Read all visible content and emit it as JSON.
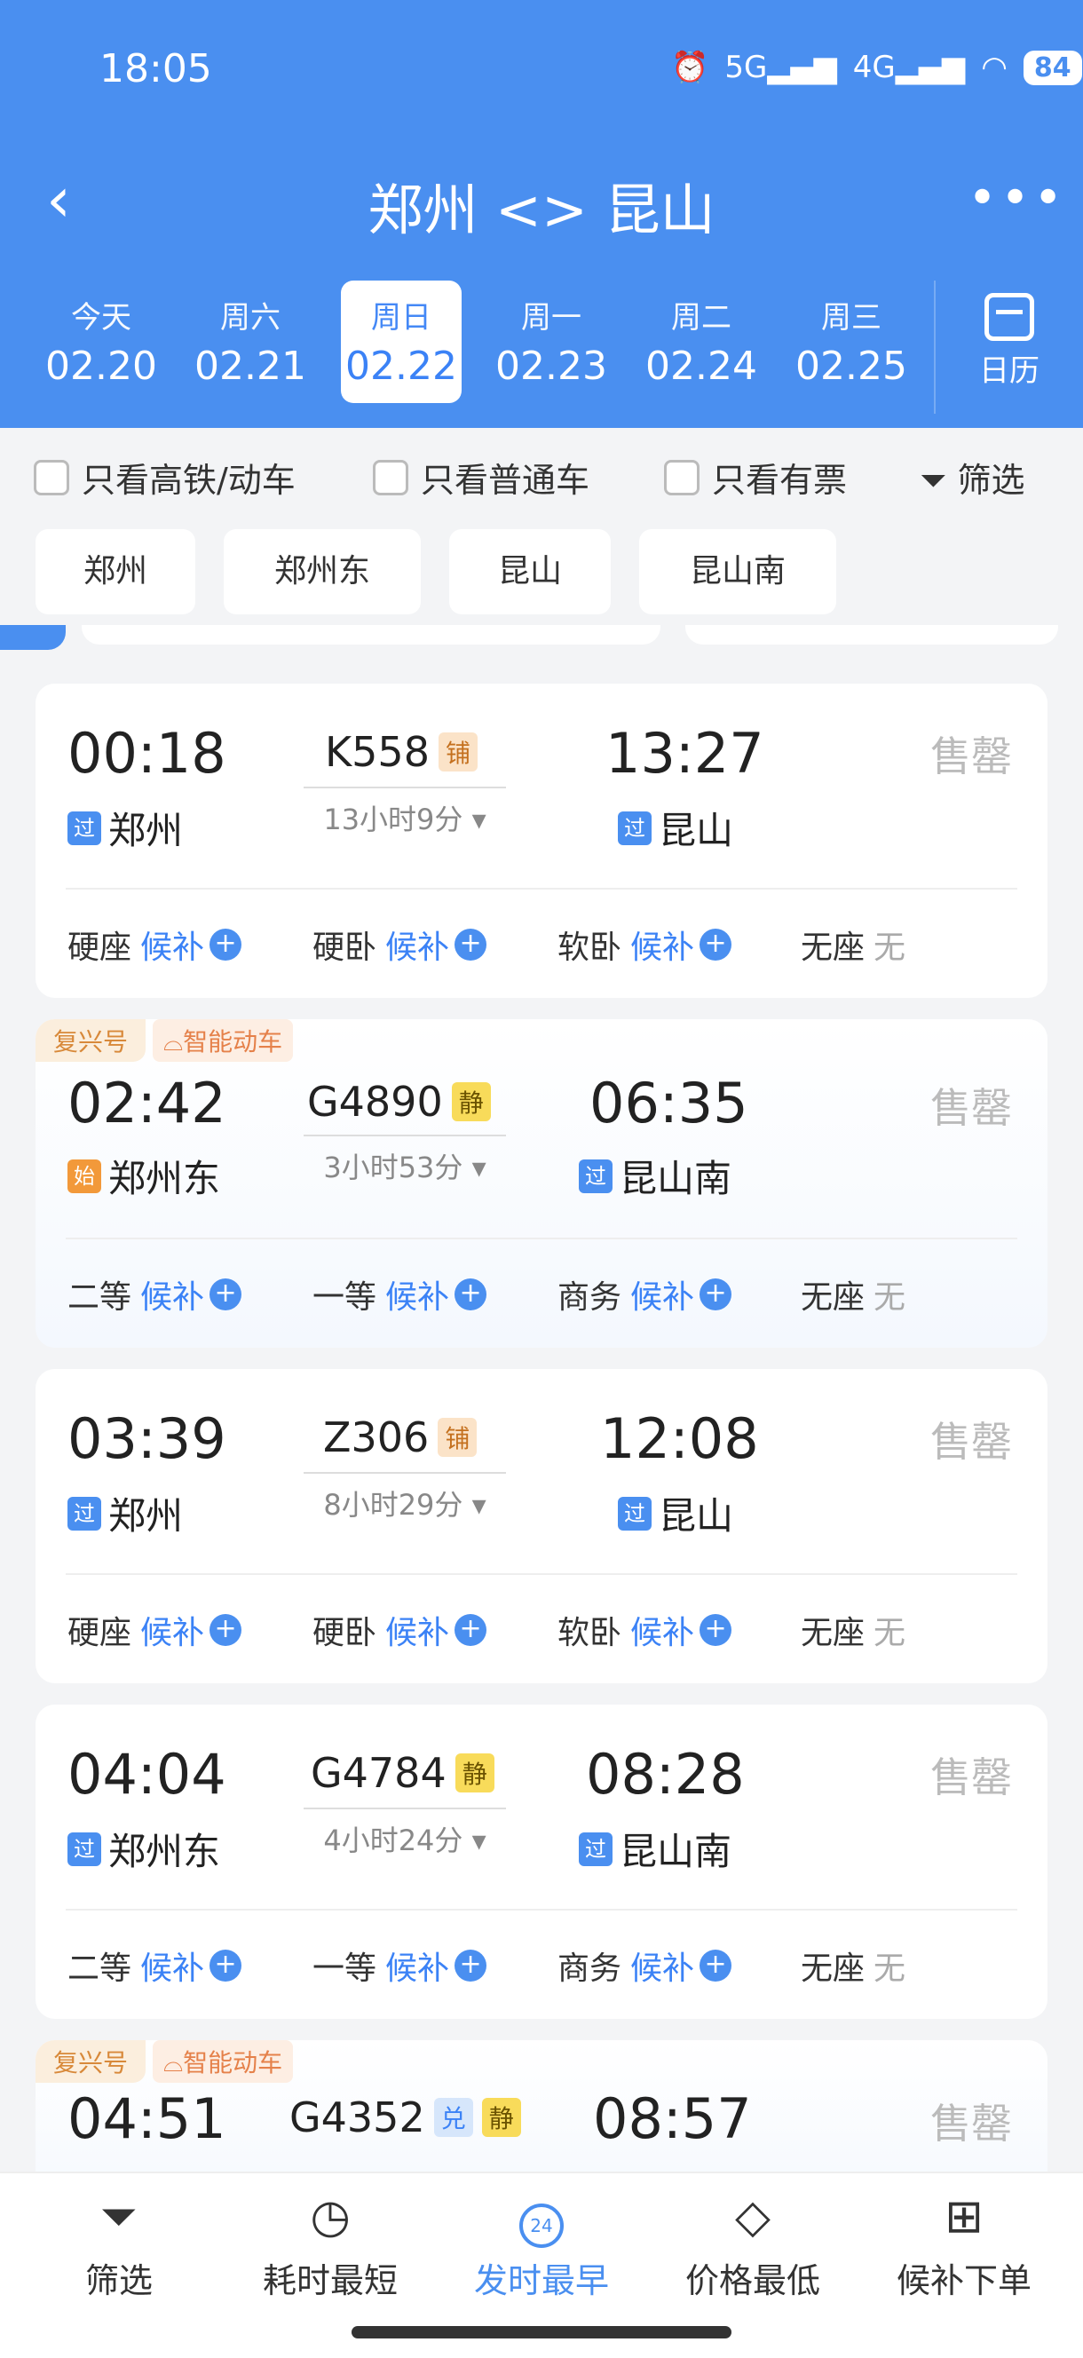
{
  "status": {
    "time": "18:05",
    "signal_5g": "5G",
    "signal_4g": "4G",
    "battery": "84"
  },
  "header": {
    "title": "郑州 <> 昆山"
  },
  "date_tabs": [
    {
      "weekday": "今天",
      "date": "02.20"
    },
    {
      "weekday": "周六",
      "date": "02.21"
    },
    {
      "weekday": "周日",
      "date": "02.22",
      "active": true
    },
    {
      "weekday": "周一",
      "date": "02.23"
    },
    {
      "weekday": "周二",
      "date": "02.24"
    },
    {
      "weekday": "周三",
      "date": "02.25"
    }
  ],
  "calendar": {
    "label": "日历"
  },
  "filters": {
    "high_speed": "只看高铁/动车",
    "normal": "只看普通车",
    "has_ticket": "只看有票",
    "filter": "筛选"
  },
  "stations": [
    "郑州",
    "郑州东",
    "昆山",
    "昆山南"
  ],
  "trains": [
    {
      "dep_time": "00:18",
      "train_no": "K558",
      "badges": [
        "铺"
      ],
      "duration": "13小时9分",
      "arr_time": "13:27",
      "dep_tag": "过",
      "dep_station": "郑州",
      "arr_tag": "过",
      "arr_station": "昆山",
      "status": "售罄",
      "seats": [
        {
          "name": "硬座",
          "state": "候补"
        },
        {
          "name": "硬卧",
          "state": "候补"
        },
        {
          "name": "软卧",
          "state": "候补"
        },
        {
          "name": "无座",
          "state": "无"
        }
      ]
    },
    {
      "tags": [
        "复兴号",
        "智能动车"
      ],
      "dep_time": "02:42",
      "train_no": "G4890",
      "badges": [
        "静"
      ],
      "duration": "3小时53分",
      "arr_time": "06:35",
      "dep_tag": "始",
      "dep_station": "郑州东",
      "arr_tag": "过",
      "arr_station": "昆山南",
      "status": "售罄",
      "seats": [
        {
          "name": "二等",
          "state": "候补"
        },
        {
          "name": "一等",
          "state": "候补"
        },
        {
          "name": "商务",
          "state": "候补"
        },
        {
          "name": "无座",
          "state": "无"
        }
      ]
    },
    {
      "dep_time": "03:39",
      "train_no": "Z306",
      "badges": [
        "铺"
      ],
      "duration": "8小时29分",
      "arr_time": "12:08",
      "dep_tag": "过",
      "dep_station": "郑州",
      "arr_tag": "过",
      "arr_station": "昆山",
      "status": "售罄",
      "seats": [
        {
          "name": "硬座",
          "state": "候补"
        },
        {
          "name": "硬卧",
          "state": "候补"
        },
        {
          "name": "软卧",
          "state": "候补"
        },
        {
          "name": "无座",
          "state": "无"
        }
      ]
    },
    {
      "dep_time": "04:04",
      "train_no": "G4784",
      "badges": [
        "静"
      ],
      "duration": "4小时24分",
      "arr_time": "08:28",
      "dep_tag": "过",
      "dep_station": "郑州东",
      "arr_tag": "过",
      "arr_station": "昆山南",
      "status": "售罄",
      "seats": [
        {
          "name": "二等",
          "state": "候补"
        },
        {
          "name": "一等",
          "state": "候补"
        },
        {
          "name": "商务",
          "state": "候补"
        },
        {
          "name": "无座",
          "state": "无"
        }
      ]
    },
    {
      "tags": [
        "复兴号",
        "智能动车"
      ],
      "dep_time": "04:51",
      "train_no": "G4352",
      "badges": [
        "兑",
        "静"
      ],
      "arr_time": "08:57",
      "status": "售罄"
    }
  ],
  "bottom_nav": [
    {
      "label": "筛选",
      "icon": "funnel-icon"
    },
    {
      "label": "耗时最短",
      "icon": "timer-icon"
    },
    {
      "label": "发时最早",
      "icon": "clock-24-icon",
      "active": true,
      "icon_text": "24"
    },
    {
      "label": "价格最低",
      "icon": "price-tag-icon"
    },
    {
      "label": "候补下单",
      "icon": "cart-icon"
    }
  ]
}
